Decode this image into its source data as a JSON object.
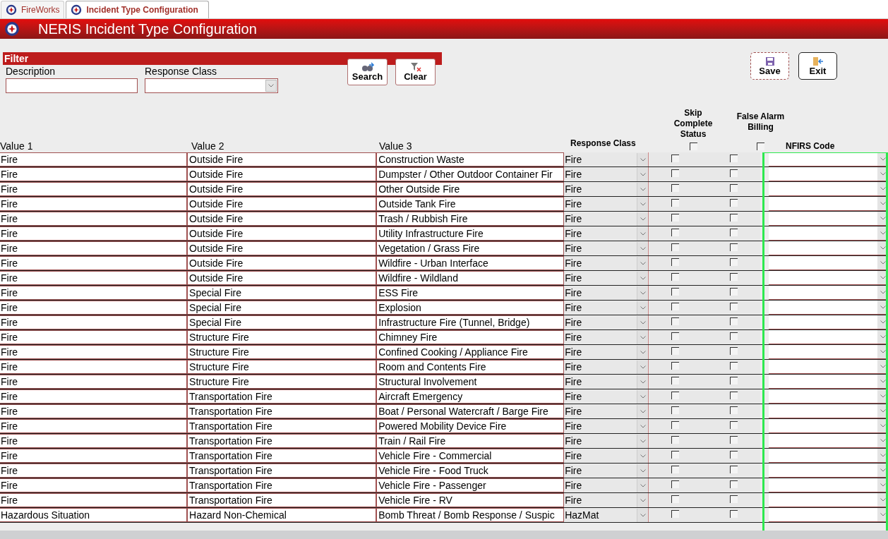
{
  "tabs": [
    {
      "label": "FireWorks",
      "selected": false
    },
    {
      "label": "Incident Type Configuration",
      "selected": true
    }
  ],
  "title": "NERIS Incident Type Configuration",
  "filter": {
    "heading": "Filter",
    "description_label": "Description",
    "response_class_label": "Response Class",
    "buttons": [
      "Search",
      "Clear"
    ]
  },
  "actions": [
    "Save",
    "Exit"
  ],
  "table": {
    "columns": [
      "Value 1",
      "Value 2",
      "Value 3",
      "Response Class",
      "Skip Complete Status",
      "False Alarm Billing",
      "NFIRS Code"
    ],
    "header_checks": {
      "skip_complete_status": false,
      "false_alarm_billing": false
    },
    "rows": [
      {
        "value_1": "Fire",
        "value_2": "Outside Fire",
        "value_3": "Construction Waste",
        "response_class": "Fire",
        "skip_complete_status": false,
        "false_alarm_billing": false
      },
      {
        "value_1": "Fire",
        "value_2": "Outside Fire",
        "value_3": "Dumpster / Other Outdoor Container Fir",
        "response_class": "Fire",
        "skip_complete_status": false,
        "false_alarm_billing": false
      },
      {
        "value_1": "Fire",
        "value_2": "Outside Fire",
        "value_3": "Other Outside Fire",
        "response_class": "Fire",
        "skip_complete_status": false,
        "false_alarm_billing": false
      },
      {
        "value_1": "Fire",
        "value_2": "Outside Fire",
        "value_3": "Outside Tank Fire",
        "response_class": "Fire",
        "skip_complete_status": false,
        "false_alarm_billing": false
      },
      {
        "value_1": "Fire",
        "value_2": "Outside Fire",
        "value_3": "Trash / Rubbish Fire",
        "response_class": "Fire",
        "skip_complete_status": false,
        "false_alarm_billing": false
      },
      {
        "value_1": "Fire",
        "value_2": "Outside Fire",
        "value_3": "Utility Infrastructure Fire",
        "response_class": "Fire",
        "skip_complete_status": false,
        "false_alarm_billing": false
      },
      {
        "value_1": "Fire",
        "value_2": "Outside Fire",
        "value_3": "Vegetation / Grass Fire",
        "response_class": "Fire",
        "skip_complete_status": false,
        "false_alarm_billing": false
      },
      {
        "value_1": "Fire",
        "value_2": "Outside Fire",
        "value_3": "Wildfire - Urban Interface",
        "response_class": "Fire",
        "skip_complete_status": false,
        "false_alarm_billing": false
      },
      {
        "value_1": "Fire",
        "value_2": "Outside Fire",
        "value_3": "Wildfire - Wildland",
        "response_class": "Fire",
        "skip_complete_status": false,
        "false_alarm_billing": false
      },
      {
        "value_1": "Fire",
        "value_2": "Special Fire",
        "value_3": "ESS Fire",
        "response_class": "Fire",
        "skip_complete_status": false,
        "false_alarm_billing": false
      },
      {
        "value_1": "Fire",
        "value_2": "Special Fire",
        "value_3": "Explosion",
        "response_class": "Fire",
        "skip_complete_status": false,
        "false_alarm_billing": false
      },
      {
        "value_1": "Fire",
        "value_2": "Special Fire",
        "value_3": "Infrastructure Fire (Tunnel, Bridge)",
        "response_class": "Fire",
        "skip_complete_status": false,
        "false_alarm_billing": false
      },
      {
        "value_1": "Fire",
        "value_2": "Structure Fire",
        "value_3": "Chimney Fire",
        "response_class": "Fire",
        "skip_complete_status": false,
        "false_alarm_billing": false
      },
      {
        "value_1": "Fire",
        "value_2": "Structure Fire",
        "value_3": "Confined Cooking / Appliance Fire",
        "response_class": "Fire",
        "skip_complete_status": false,
        "false_alarm_billing": false
      },
      {
        "value_1": "Fire",
        "value_2": "Structure Fire",
        "value_3": "Room and Contents Fire",
        "response_class": "Fire",
        "skip_complete_status": false,
        "false_alarm_billing": false
      },
      {
        "value_1": "Fire",
        "value_2": "Structure Fire",
        "value_3": "Structural Involvement",
        "response_class": "Fire",
        "skip_complete_status": false,
        "false_alarm_billing": false
      },
      {
        "value_1": "Fire",
        "value_2": "Transportation Fire",
        "value_3": "Aircraft Emergency",
        "response_class": "Fire",
        "skip_complete_status": false,
        "false_alarm_billing": false
      },
      {
        "value_1": "Fire",
        "value_2": "Transportation Fire",
        "value_3": "Boat / Personal Watercraft / Barge Fire",
        "response_class": "Fire",
        "skip_complete_status": false,
        "false_alarm_billing": false
      },
      {
        "value_1": "Fire",
        "value_2": "Transportation Fire",
        "value_3": "Powered Mobility Device Fire",
        "response_class": "Fire",
        "skip_complete_status": false,
        "false_alarm_billing": false
      },
      {
        "value_1": "Fire",
        "value_2": "Transportation Fire",
        "value_3": "Train / Rail Fire",
        "response_class": "Fire",
        "skip_complete_status": false,
        "false_alarm_billing": false
      },
      {
        "value_1": "Fire",
        "value_2": "Transportation Fire",
        "value_3": "Vehicle Fire - Commercial",
        "response_class": "Fire",
        "skip_complete_status": false,
        "false_alarm_billing": false
      },
      {
        "value_1": "Fire",
        "value_2": "Transportation Fire",
        "value_3": "Vehicle Fire - Food Truck",
        "response_class": "Fire",
        "skip_complete_status": false,
        "false_alarm_billing": false
      },
      {
        "value_1": "Fire",
        "value_2": "Transportation Fire",
        "value_3": "Vehicle Fire - Passenger",
        "response_class": "Fire",
        "skip_complete_status": false,
        "false_alarm_billing": false
      },
      {
        "value_1": "Fire",
        "value_2": "Transportation Fire",
        "value_3": "Vehicle Fire - RV",
        "response_class": "Fire",
        "skip_complete_status": false,
        "false_alarm_billing": false
      },
      {
        "value_1": "Hazardous Situation",
        "value_2": "Hazard Non-Chemical",
        "value_3": "Bomb Threat / Bomb Response / Suspic",
        "response_class": "HazMat",
        "skip_complete_status": false,
        "false_alarm_billing": false
      }
    ]
  }
}
